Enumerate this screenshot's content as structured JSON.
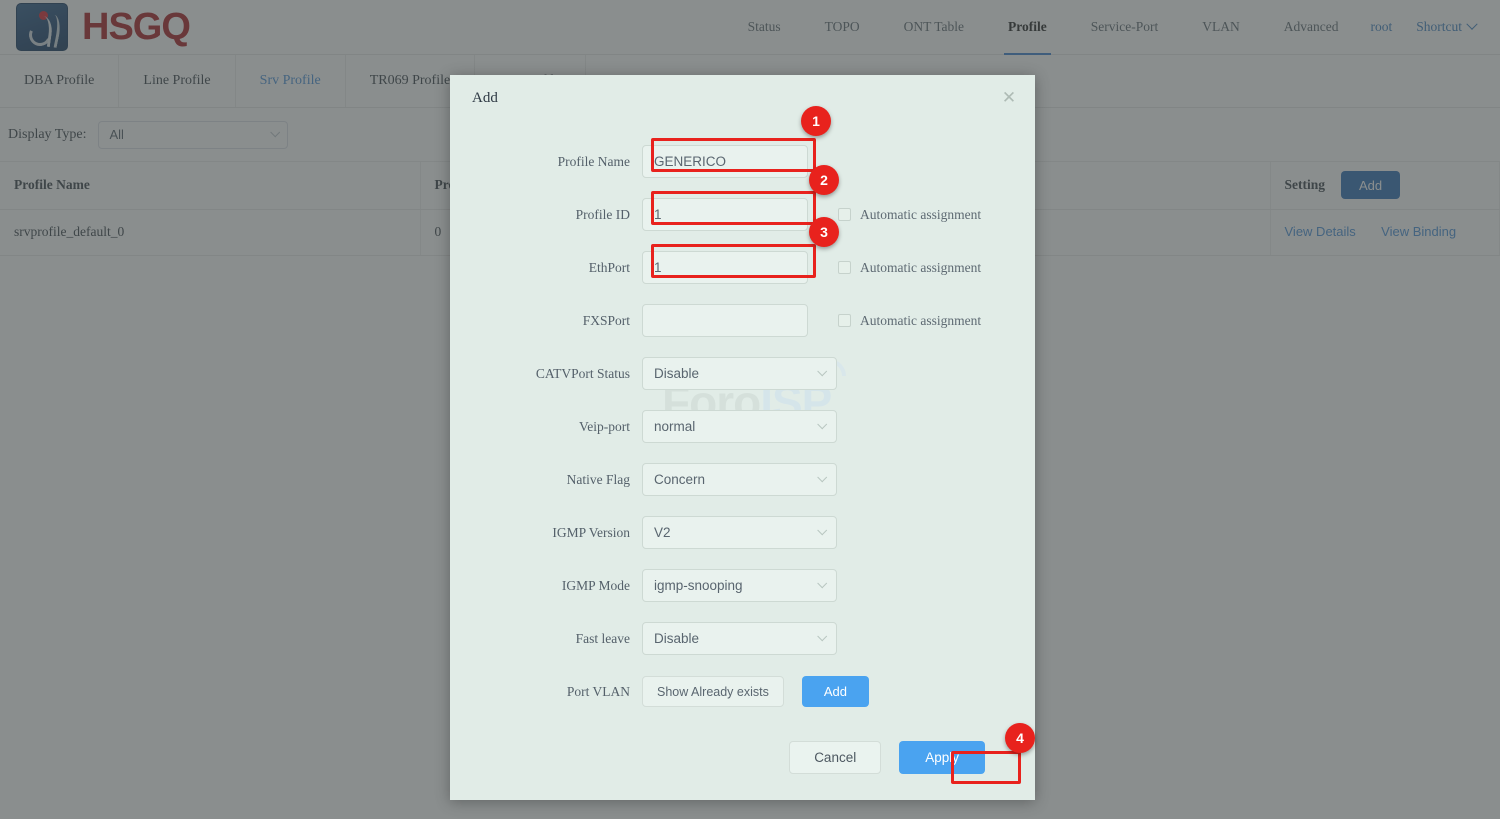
{
  "brand": {
    "name": "HSGQ",
    "logo_icon": "hsgq-logo-icon"
  },
  "topnav": {
    "items": [
      {
        "label": "Status",
        "active": false
      },
      {
        "label": "TOPO",
        "active": false
      },
      {
        "label": "ONT Table",
        "active": false
      },
      {
        "label": "Profile",
        "active": true
      },
      {
        "label": "Service-Port",
        "active": false
      },
      {
        "label": "VLAN",
        "active": false
      },
      {
        "label": "Advanced",
        "active": false
      }
    ],
    "user": "root",
    "shortcut": "Shortcut",
    "chevron_icon": "chevron-down-icon"
  },
  "subtabs": [
    {
      "label": "DBA Profile",
      "active": false
    },
    {
      "label": "Line Profile",
      "active": false
    },
    {
      "label": "Srv Profile",
      "active": true
    },
    {
      "label": "TR069 Profile",
      "active": false
    },
    {
      "label": "SIP Profile",
      "active": false
    }
  ],
  "filter": {
    "label": "Display Type:",
    "value": "All",
    "caret_icon": "chevron-down-icon"
  },
  "table": {
    "columns": [
      "Profile Name",
      "Profile ID",
      "Setting"
    ],
    "add_button": "Add",
    "rows": [
      {
        "profile_name": "srvprofile_default_0",
        "profile_id": "0",
        "links": [
          "View Details",
          "View Binding"
        ]
      }
    ]
  },
  "dialog": {
    "title": "Add",
    "close_icon": "close-icon",
    "fields": [
      {
        "label": "Profile Name",
        "value": "GENERICO",
        "type": "input",
        "checkbox": null
      },
      {
        "label": "Profile ID",
        "value": "1",
        "type": "input",
        "checkbox": "Automatic assignment"
      },
      {
        "label": "EthPort",
        "value": "1",
        "type": "input",
        "checkbox": "Automatic assignment"
      },
      {
        "label": "FXSPort",
        "value": "",
        "type": "input",
        "checkbox": "Automatic assignment"
      },
      {
        "label": "CATVPort Status",
        "value": "Disable",
        "type": "select",
        "checkbox": null
      },
      {
        "label": "Veip-port",
        "value": "normal",
        "type": "select",
        "checkbox": null
      },
      {
        "label": "Native Flag",
        "value": "Concern",
        "type": "select",
        "checkbox": null
      },
      {
        "label": "IGMP Version",
        "value": "V2",
        "type": "select",
        "checkbox": null
      },
      {
        "label": "IGMP Mode",
        "value": "igmp-snooping",
        "type": "select",
        "checkbox": null
      },
      {
        "label": "Fast leave",
        "value": "Disable",
        "type": "select",
        "checkbox": null
      }
    ],
    "port_vlan": {
      "label": "Port VLAN",
      "show_button": "Show Already exists",
      "add_button": "Add"
    },
    "footer": {
      "cancel": "Cancel",
      "apply": "Apply"
    }
  },
  "annotations": {
    "accent_color": "#e8221d",
    "badges": [
      {
        "number": "1",
        "target": "profile-name-field"
      },
      {
        "number": "2",
        "target": "profile-id-field"
      },
      {
        "number": "3",
        "target": "ethport-field"
      },
      {
        "number": "4",
        "target": "apply-button"
      }
    ]
  },
  "watermark": {
    "part1": "Foro",
    "part2": "ISP"
  }
}
